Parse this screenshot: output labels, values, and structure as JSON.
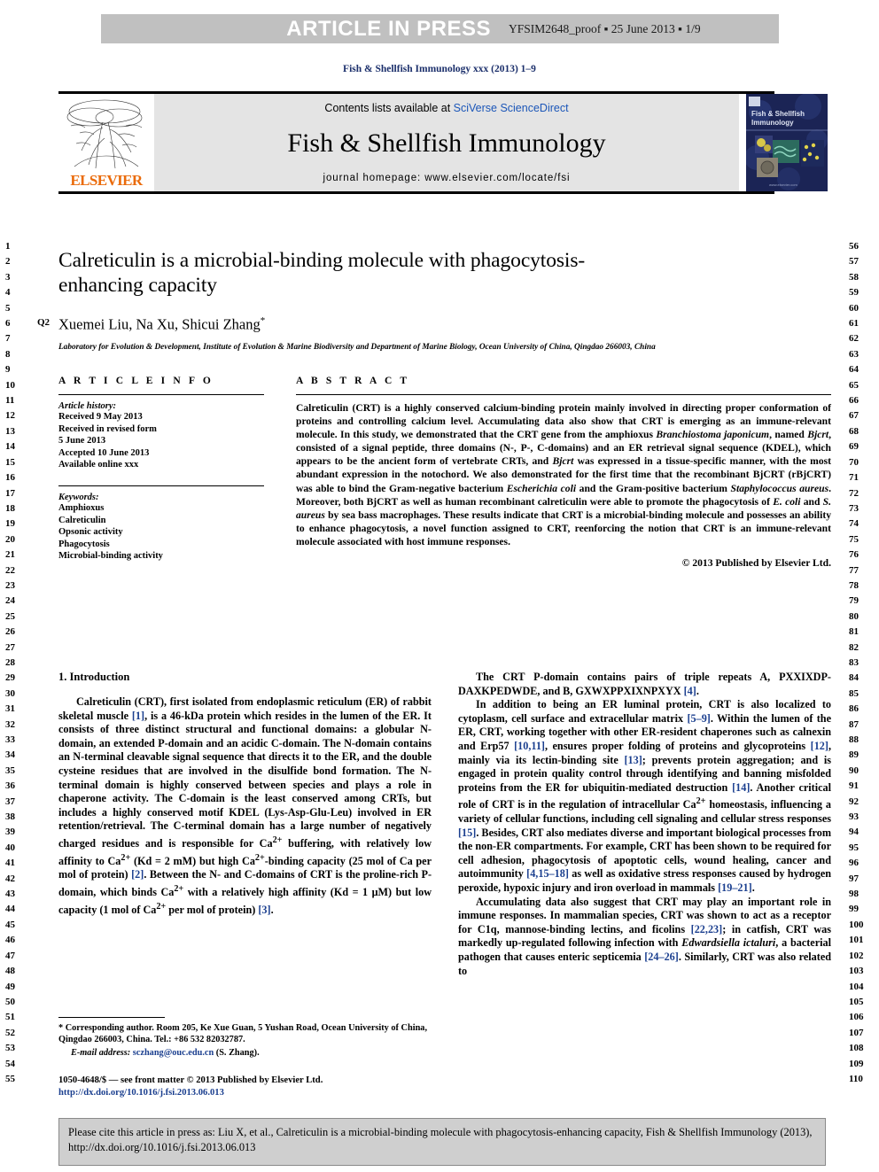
{
  "banner": {
    "press_label": "ARTICLE IN PRESS",
    "proof_meta": "YFSIM2648_proof ▪ 25 June 2013 ▪ 1/9"
  },
  "journal_ref": "Fish & Shellfish Immunology xxx (2013) 1–9",
  "masthead": {
    "contents_prefix": "Contents lists available at ",
    "sciencedirect": "SciVerse ScienceDirect",
    "journal_title": "Fish & Shellfish Immunology",
    "homepage": "journal homepage: www.elsevier.com/locate/fsi",
    "publisher": "ELSEVIER",
    "cover_title_line1": "Fish & Shellfish",
    "cover_title_line2": "Immunology"
  },
  "article": {
    "title": "Calreticulin is a microbial-binding molecule with phagocytosis-enhancing capacity",
    "query_marker": "Q2",
    "authors": "Xuemei Liu, Na Xu, Shicui Zhang",
    "author_star": "*",
    "affiliation": "Laboratory for Evolution & Development, Institute of Evolution & Marine Biodiversity and Department of Marine Biology, Ocean University of China, Qingdao 266003, China"
  },
  "article_info": {
    "heading": "A R T I C L E   I N F O",
    "history_label": "Article history:",
    "history": [
      "Received 9 May 2013",
      "Received in revised form",
      "5 June 2013",
      "Accepted 10 June 2013",
      "Available online xxx"
    ],
    "keywords_label": "Keywords:",
    "keywords": [
      "Amphioxus",
      "Calreticulin",
      "Opsonic activity",
      "Phagocytosis",
      "Microbial-binding activity"
    ]
  },
  "abstract": {
    "heading": "A B S T R A C T",
    "paragraphs": [
      "Calreticulin (CRT) is a highly conserved calcium-binding protein mainly involved in directing proper conformation of proteins and controlling calcium level. Accumulating data also show that CRT is emerging as an immune-relevant molecule. In this study, we demonstrated that the CRT gene from the amphioxus Branchiostoma japonicum, named Bjcrt, consisted of a signal peptide, three domains (N-, P-, C-domains) and an ER retrieval signal sequence (KDEL), which appears to be the ancient form of vertebrate CRTs, and Bjcrt was expressed in a tissue-specific manner, with the most abundant expression in the notochord. We also demonstrated for the first time that the recombinant BjCRT (rBjCRT) was able to bind the Gram-negative bacterium Escherichia coli and the Gram-positive bacterium Staphylococcus aureus. Moreover, both BjCRT as well as human recombinant calreticulin were able to promote the phagocytosis of E. coli and S. aureus by sea bass macrophages. These results indicate that CRT is a microbial-binding molecule and possesses an ability to enhance phagocytosis, a novel function assigned to CRT, reenforcing the notion that CRT is an immune-relevant molecule associated with host immune responses."
    ],
    "copyright": "© 2013 Published by Elsevier Ltd."
  },
  "introduction": {
    "heading": "1.  Introduction",
    "left_paragraphs": [
      "Calreticulin (CRT), first isolated from endoplasmic reticulum (ER) of rabbit skeletal muscle [1], is a 46-kDa protein which resides in the lumen of the ER. It consists of three distinct structural and functional domains: a globular N-domain, an extended P-domain and an acidic C-domain. The N-domain contains an N-terminal cleavable signal sequence that directs it to the ER, and the double cysteine residues that are involved in the disulfide bond formation. The N-terminal domain is highly conserved between species and plays a role in chaperone activity. The C-domain is the least conserved among CRTs, but includes a highly conserved motif KDEL (Lys-Asp-Glu-Leu) involved in ER retention/retrieval. The C-terminal domain has a large number of negatively charged residues and is responsible for Ca2+ buffering, with relatively low affinity to Ca2+ (Kd = 2 mM) but high Ca2+-binding capacity (25 mol of Ca per mol of protein) [2]. Between the N- and C-domains of CRT is the proline-rich P-domain, which binds Ca2+ with a relatively high affinity (Kd = 1 μM) but low capacity (1 mol of Ca2+ per mol of protein) [3]."
    ],
    "right_paragraphs": [
      "The CRT P-domain contains pairs of triple repeats A, PXXIXDP-DAXKPEDWDE, and B, GXWXPPXIXNPXYX [4].",
      "In addition to being an ER luminal protein, CRT is also localized to cytoplasm, cell surface and extracellular matrix [5–9]. Within the lumen of the ER, CRT, working together with other ER-resident chaperones such as calnexin and Erp57 [10,11], ensures proper folding of proteins and glycoproteins [12], mainly via its lectin-binding site [13]; prevents protein aggregation; and is engaged in protein quality control through identifying and banning misfolded proteins from the ER for ubiquitin-mediated destruction [14]. Another critical role of CRT is in the regulation of intracellular Ca2+ homeostasis, influencing a variety of cellular functions, including cell signaling and cellular stress responses [15]. Besides, CRT also mediates diverse and important biological processes from the non-ER compartments. For example, CRT has been shown to be required for cell adhesion, phagocytosis of apoptotic cells, wound healing, cancer and autoimmunity [4,15–18] as well as oxidative stress responses caused by hydrogen peroxide, hypoxic injury and iron overload in mammals [19–21].",
      "Accumulating data also suggest that CRT may play an important role in immune responses. In mammalian species, CRT was shown to act as a receptor for C1q, mannose-binding lectins, and ficolins [22,23]; in catfish, CRT was markedly up-regulated following infection with Edwardsiella ictaluri, a bacterial pathogen that causes enteric septicemia [24–26]. Similarly, CRT was also related to"
    ]
  },
  "footnote": {
    "corresponding": "* Corresponding author. Room 205, Ke Xue Guan, 5 Yushan Road, Ocean University of China, Qingdao 266003, China. Tel.: +86 532 82032787.",
    "email_label": "E-mail address:",
    "email": "sczhang@ouc.edu.cn",
    "email_suffix": " (S. Zhang)."
  },
  "frontmatter": {
    "line1": "1050-4648/$ — see front matter © 2013 Published by Elsevier Ltd.",
    "doi": "http://dx.doi.org/10.1016/j.fsi.2013.06.013"
  },
  "cite_box": {
    "text": "Please cite this article in press as: Liu X, et al., Calreticulin is a microbial-binding molecule with phagocytosis-enhancing capacity, Fish & Shellfish Immunology (2013), http://dx.doi.org/10.1016/j.fsi.2013.06.013"
  },
  "line_numbers": {
    "left_start": 1,
    "left_end": 55,
    "right_start": 56,
    "right_end": 110
  },
  "colors": {
    "banner_bg": "#c0c0c0",
    "masthead_bg": "#e4e4e4",
    "link_blue": "#1b56b8",
    "ref_blue": "#1b3f8f",
    "elsevier_orange": "#ea6b0b",
    "journal_ref_blue": "#1b2f6b",
    "cite_box_bg": "#cfcfcf"
  }
}
